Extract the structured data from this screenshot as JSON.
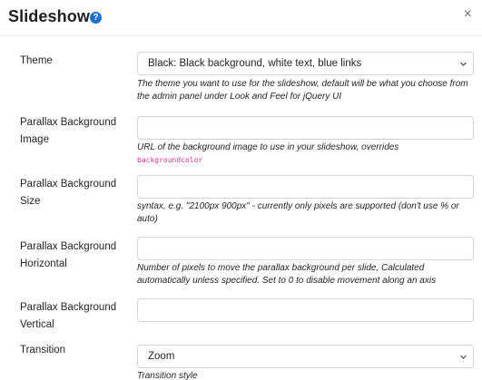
{
  "dialog": {
    "title": "Slideshow",
    "help_icon": "question-circle-icon",
    "close_glyph": "×"
  },
  "fields": {
    "theme": {
      "label": "Theme",
      "value": "Black: Black background, white text, blue links",
      "help": "The theme you want to use for the slideshow, default will be what you choose from the admin panel under Look and Feel for jQuery UI"
    },
    "parallax_image": {
      "label": "Parallax Background Image",
      "value": "",
      "help": "URL of the background image to use in your slideshow, overrides",
      "help_code": "backgroundcolor"
    },
    "parallax_size": {
      "label": "Parallax Background Size",
      "value": "",
      "help": "syntax, e.g. \"2100px 900px\" - currently only pixels are supported (don't use % or auto)"
    },
    "parallax_horizontal": {
      "label": "Parallax Background Horizontal",
      "value": "",
      "help": "Number of pixels to move the parallax background per slide, Calculated automatically unless specified. Set to 0 to disable movement along an axis"
    },
    "parallax_vertical": {
      "label": "Parallax Background Vertical",
      "value": ""
    },
    "transition": {
      "label": "Transition",
      "value": "Zoom",
      "help": "Transition style"
    }
  },
  "colors": {
    "accent": "#1f6fd0",
    "code": "#d63384",
    "border": "#ced4da"
  }
}
